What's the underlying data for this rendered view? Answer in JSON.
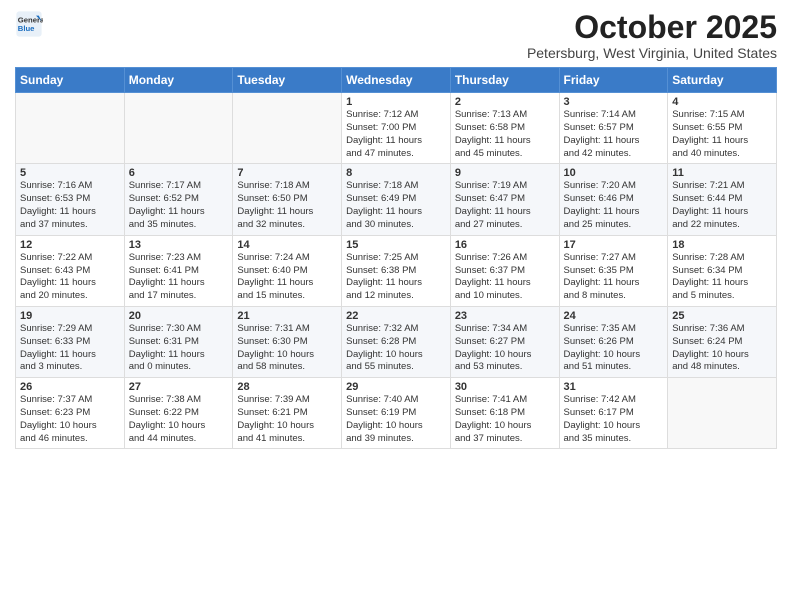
{
  "header": {
    "logo_general": "General",
    "logo_blue": "Blue",
    "month_title": "October 2025",
    "location": "Petersburg, West Virginia, United States"
  },
  "days_of_week": [
    "Sunday",
    "Monday",
    "Tuesday",
    "Wednesday",
    "Thursday",
    "Friday",
    "Saturday"
  ],
  "weeks": [
    [
      {
        "day": "",
        "info": ""
      },
      {
        "day": "",
        "info": ""
      },
      {
        "day": "",
        "info": ""
      },
      {
        "day": "1",
        "info": "Sunrise: 7:12 AM\nSunset: 7:00 PM\nDaylight: 11 hours\nand 47 minutes."
      },
      {
        "day": "2",
        "info": "Sunrise: 7:13 AM\nSunset: 6:58 PM\nDaylight: 11 hours\nand 45 minutes."
      },
      {
        "day": "3",
        "info": "Sunrise: 7:14 AM\nSunset: 6:57 PM\nDaylight: 11 hours\nand 42 minutes."
      },
      {
        "day": "4",
        "info": "Sunrise: 7:15 AM\nSunset: 6:55 PM\nDaylight: 11 hours\nand 40 minutes."
      }
    ],
    [
      {
        "day": "5",
        "info": "Sunrise: 7:16 AM\nSunset: 6:53 PM\nDaylight: 11 hours\nand 37 minutes."
      },
      {
        "day": "6",
        "info": "Sunrise: 7:17 AM\nSunset: 6:52 PM\nDaylight: 11 hours\nand 35 minutes."
      },
      {
        "day": "7",
        "info": "Sunrise: 7:18 AM\nSunset: 6:50 PM\nDaylight: 11 hours\nand 32 minutes."
      },
      {
        "day": "8",
        "info": "Sunrise: 7:18 AM\nSunset: 6:49 PM\nDaylight: 11 hours\nand 30 minutes."
      },
      {
        "day": "9",
        "info": "Sunrise: 7:19 AM\nSunset: 6:47 PM\nDaylight: 11 hours\nand 27 minutes."
      },
      {
        "day": "10",
        "info": "Sunrise: 7:20 AM\nSunset: 6:46 PM\nDaylight: 11 hours\nand 25 minutes."
      },
      {
        "day": "11",
        "info": "Sunrise: 7:21 AM\nSunset: 6:44 PM\nDaylight: 11 hours\nand 22 minutes."
      }
    ],
    [
      {
        "day": "12",
        "info": "Sunrise: 7:22 AM\nSunset: 6:43 PM\nDaylight: 11 hours\nand 20 minutes."
      },
      {
        "day": "13",
        "info": "Sunrise: 7:23 AM\nSunset: 6:41 PM\nDaylight: 11 hours\nand 17 minutes."
      },
      {
        "day": "14",
        "info": "Sunrise: 7:24 AM\nSunset: 6:40 PM\nDaylight: 11 hours\nand 15 minutes."
      },
      {
        "day": "15",
        "info": "Sunrise: 7:25 AM\nSunset: 6:38 PM\nDaylight: 11 hours\nand 12 minutes."
      },
      {
        "day": "16",
        "info": "Sunrise: 7:26 AM\nSunset: 6:37 PM\nDaylight: 11 hours\nand 10 minutes."
      },
      {
        "day": "17",
        "info": "Sunrise: 7:27 AM\nSunset: 6:35 PM\nDaylight: 11 hours\nand 8 minutes."
      },
      {
        "day": "18",
        "info": "Sunrise: 7:28 AM\nSunset: 6:34 PM\nDaylight: 11 hours\nand 5 minutes."
      }
    ],
    [
      {
        "day": "19",
        "info": "Sunrise: 7:29 AM\nSunset: 6:33 PM\nDaylight: 11 hours\nand 3 minutes."
      },
      {
        "day": "20",
        "info": "Sunrise: 7:30 AM\nSunset: 6:31 PM\nDaylight: 11 hours\nand 0 minutes."
      },
      {
        "day": "21",
        "info": "Sunrise: 7:31 AM\nSunset: 6:30 PM\nDaylight: 10 hours\nand 58 minutes."
      },
      {
        "day": "22",
        "info": "Sunrise: 7:32 AM\nSunset: 6:28 PM\nDaylight: 10 hours\nand 55 minutes."
      },
      {
        "day": "23",
        "info": "Sunrise: 7:34 AM\nSunset: 6:27 PM\nDaylight: 10 hours\nand 53 minutes."
      },
      {
        "day": "24",
        "info": "Sunrise: 7:35 AM\nSunset: 6:26 PM\nDaylight: 10 hours\nand 51 minutes."
      },
      {
        "day": "25",
        "info": "Sunrise: 7:36 AM\nSunset: 6:24 PM\nDaylight: 10 hours\nand 48 minutes."
      }
    ],
    [
      {
        "day": "26",
        "info": "Sunrise: 7:37 AM\nSunset: 6:23 PM\nDaylight: 10 hours\nand 46 minutes."
      },
      {
        "day": "27",
        "info": "Sunrise: 7:38 AM\nSunset: 6:22 PM\nDaylight: 10 hours\nand 44 minutes."
      },
      {
        "day": "28",
        "info": "Sunrise: 7:39 AM\nSunset: 6:21 PM\nDaylight: 10 hours\nand 41 minutes."
      },
      {
        "day": "29",
        "info": "Sunrise: 7:40 AM\nSunset: 6:19 PM\nDaylight: 10 hours\nand 39 minutes."
      },
      {
        "day": "30",
        "info": "Sunrise: 7:41 AM\nSunset: 6:18 PM\nDaylight: 10 hours\nand 37 minutes."
      },
      {
        "day": "31",
        "info": "Sunrise: 7:42 AM\nSunset: 6:17 PM\nDaylight: 10 hours\nand 35 minutes."
      },
      {
        "day": "",
        "info": ""
      }
    ]
  ]
}
